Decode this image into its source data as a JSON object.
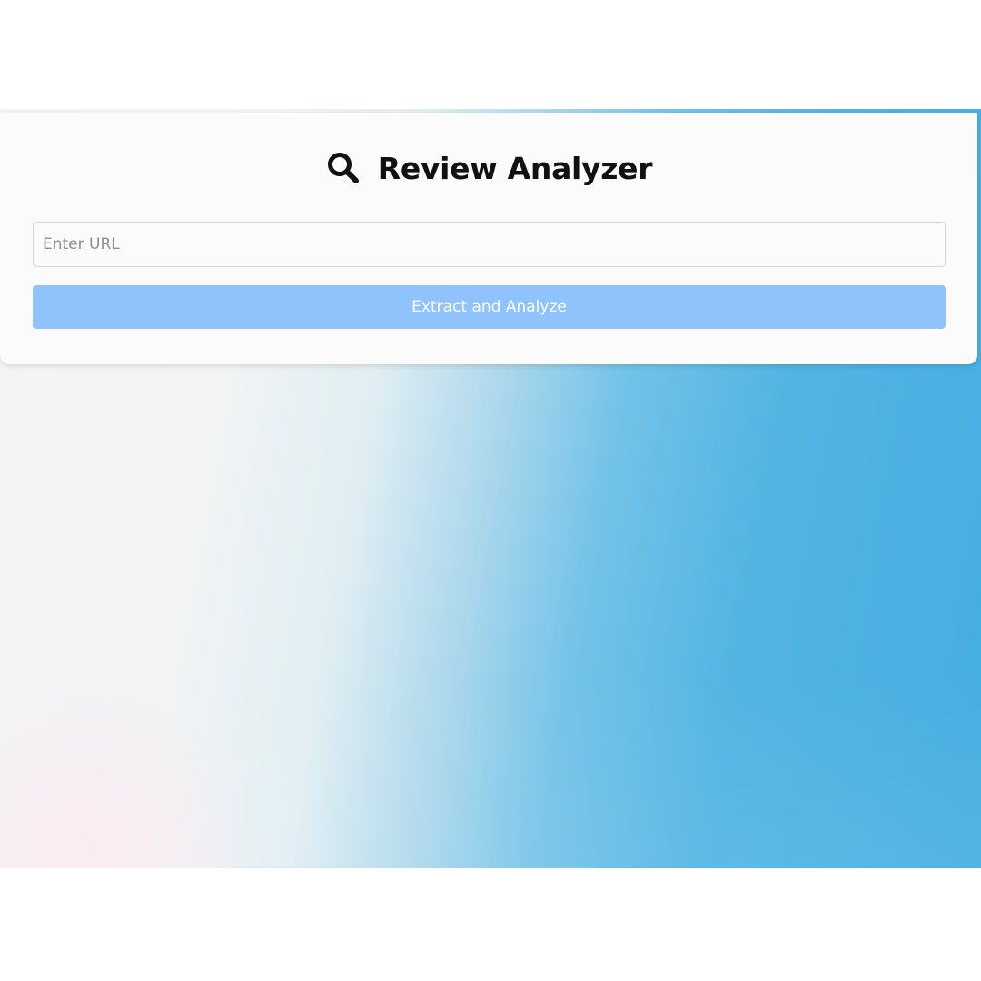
{
  "app": {
    "title": "Review Analyzer",
    "title_icon": "search-icon"
  },
  "form": {
    "url_placeholder": "Enter URL",
    "url_value": "",
    "submit_label": "Extract and Analyze"
  },
  "colors": {
    "button_background": "#90c2fb",
    "button_text": "#ffffff",
    "background_blue": "#44aee1",
    "background_light": "#f3f4f5"
  }
}
